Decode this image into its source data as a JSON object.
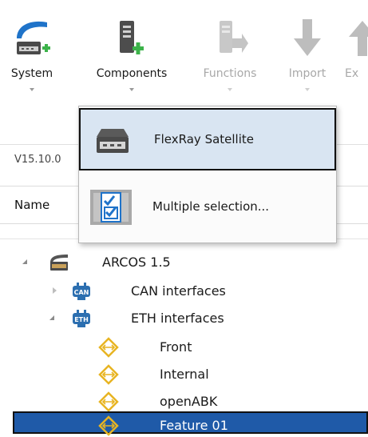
{
  "ribbon": {
    "buttons": [
      {
        "label": "System",
        "icon": "system-add-icon",
        "disabled": false
      },
      {
        "label": "Components",
        "icon": "components-add-icon",
        "disabled": false
      },
      {
        "label": "Functions",
        "icon": "functions-icon",
        "disabled": true
      },
      {
        "label": "Import",
        "icon": "import-icon",
        "disabled": true
      },
      {
        "label": "Ex",
        "icon": "export-icon",
        "disabled": true
      }
    ]
  },
  "version": "V15.10.0",
  "columns": {
    "name": "Name"
  },
  "dropdown": {
    "items": [
      {
        "label": "FlexRay Satellite",
        "icon": "flexray-satellite-icon"
      },
      {
        "label": "Multiple selection...",
        "icon": "multiple-selection-icon"
      }
    ]
  },
  "tree": {
    "items": [
      {
        "label": "ARCOS 1.5",
        "icon": "device-icon",
        "expander": "open"
      },
      {
        "label": "CAN interfaces",
        "icon": "can-icon",
        "expander": "closed"
      },
      {
        "label": "ETH interfaces",
        "icon": "eth-icon",
        "expander": "open"
      },
      {
        "label": "Front",
        "icon": "interface-icon",
        "expander": "none"
      },
      {
        "label": "Internal",
        "icon": "interface-icon",
        "expander": "none"
      },
      {
        "label": "openABK",
        "icon": "interface-icon",
        "expander": "none"
      },
      {
        "label": "Feature 01",
        "icon": "interface-icon",
        "expander": "none",
        "selected": true
      }
    ]
  },
  "colors": {
    "selection": "#1f5aa8",
    "add_green": "#3cb34a",
    "accent_blue": "#1f73c9"
  }
}
